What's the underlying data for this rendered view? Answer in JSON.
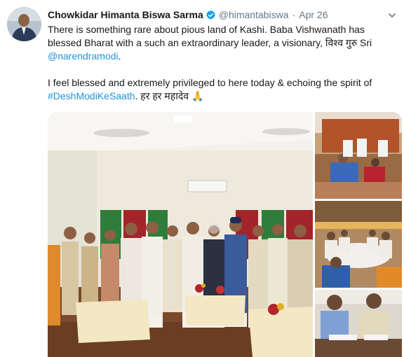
{
  "tweet": {
    "author_name": "Chowkidar Himanta Biswa Sarma",
    "handle": "@himantabiswa",
    "separator": "·",
    "date": "Apr 26",
    "verified": true,
    "text_line1_plain": "There is something rare about pious land of Kashi. Baba Vishwanath has blessed Bharat with a such an extraordinary leader, a visionary, विश्व गुरु Sri ",
    "mention": "@narendramodi",
    "text_line1_end": ".",
    "text_line2_plain": "I feel blessed and extremely privileged to here today & echoing the spirit of ",
    "hashtag": "#DeshModiKeSaath",
    "text_line2_end": ". हर हर महादेव 🙏"
  },
  "icons": {
    "avatar": "avatar",
    "verified": "verified-badge-icon",
    "caret": "chevron-down-icon"
  },
  "colors": {
    "link": "#1b95e0",
    "secondary_text": "#657786",
    "verified": "#1da1f2"
  },
  "media": {
    "count": 4
  }
}
